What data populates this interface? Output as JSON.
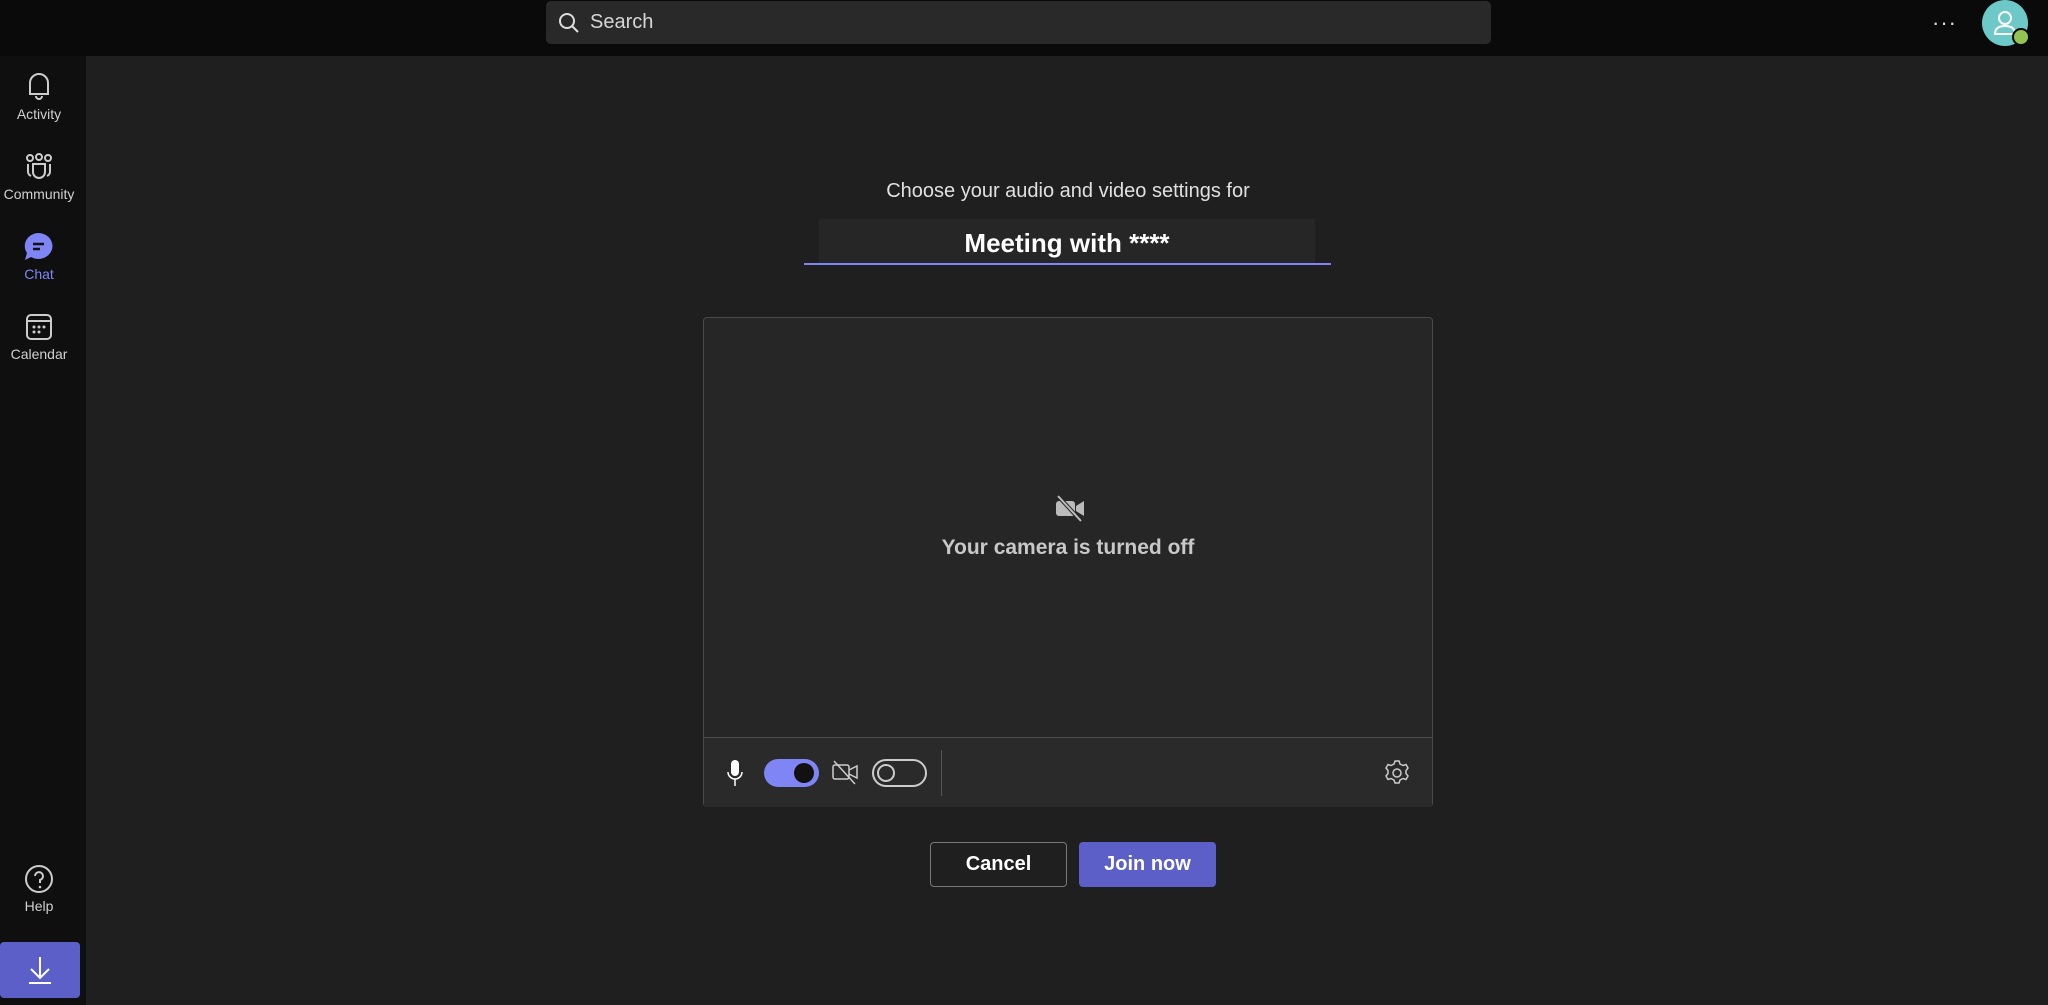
{
  "search": {
    "placeholder": "Search",
    "icon": "search-icon"
  },
  "header": {
    "more_icon": "more-icon",
    "more_label": "···",
    "avatar_icon": "person-icon",
    "presence": "available"
  },
  "sidebar": {
    "items": [
      {
        "label": "Activity",
        "icon": "bell-icon",
        "active": false
      },
      {
        "label": "Community",
        "icon": "community-icon",
        "active": false
      },
      {
        "label": "Chat",
        "icon": "chat-icon",
        "active": true
      },
      {
        "label": "Calendar",
        "icon": "calendar-icon",
        "active": false
      }
    ],
    "help": {
      "label": "Help",
      "icon": "help-icon"
    },
    "download_icon": "download-icon"
  },
  "prejoin": {
    "prompt": "Choose your audio and video settings for",
    "meeting_title": "Meeting with ****",
    "camera_status": "Your camera is turned off",
    "mic_on": true,
    "camera_on": false,
    "cancel_label": "Cancel",
    "join_label": "Join now"
  },
  "colors": {
    "accent": "#7f85f5",
    "primary_button": "#5b5fc7",
    "presence": "#92c353",
    "avatar": "#6dc9c7"
  }
}
